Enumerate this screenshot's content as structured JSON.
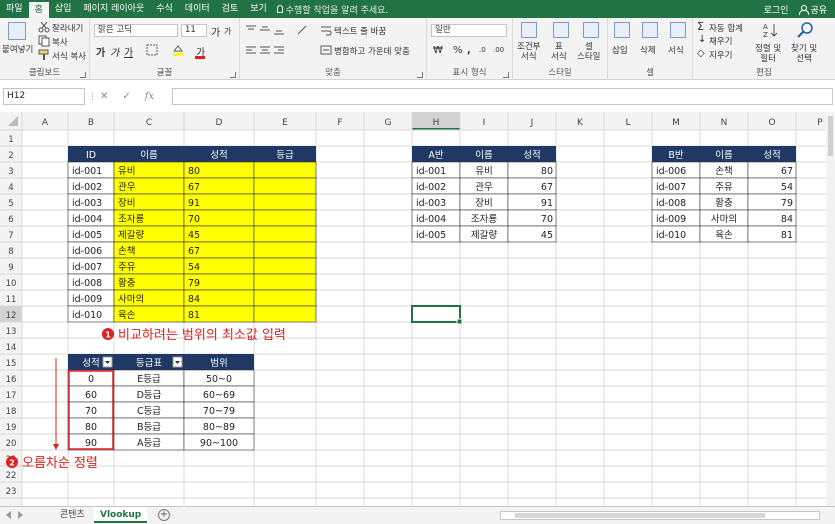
{
  "ribbon_tabs": [
    "파일",
    "홈",
    "삽입",
    "페이지 레이아웃",
    "수식",
    "데이터",
    "검토",
    "보기"
  ],
  "active_tab": "홈",
  "tell_me_placeholder": "수행할 작업을 알려 주세요.",
  "account": {
    "login": "로그인",
    "share": "공유"
  },
  "ribbon": {
    "clipboard": {
      "paste": "붙여넣기",
      "cut": "잘라내기",
      "copy": "복사 ",
      "format_painter": "서식 복사",
      "title": "클립보드"
    },
    "font": {
      "font_name": "맑은 고딕",
      "font_size": "11",
      "grow": "가",
      "shrink": "가",
      "bold": "가",
      "italic": "가",
      "underline": "가",
      "strike": "가",
      "title": "글꼴"
    },
    "alignment": {
      "wrap_text": "텍스트 줄 바꿈",
      "merge_center": "병합하고 가운데 맞춤",
      "title": "맞춤"
    },
    "number": {
      "format": "일반",
      "title": "표시 형식"
    },
    "styles": {
      "conditional": "조건부\n서식",
      "table": "표\n서식",
      "cell": "셀\n스타일",
      "conditional_1": "조건부",
      "conditional_2": "서식 ",
      "table_1": "표",
      "table_2": "서식 ",
      "cell_1": "셀",
      "cell_2": "스타일 ",
      "title": "스타일"
    },
    "cells": {
      "insert": "삽입",
      "delete": "삭제",
      "format": "서식",
      "title": "셀"
    },
    "editing": {
      "autosum": "자동 합계",
      "fill": "채우기",
      "clear": "지우기",
      "sort_filter_1": "정렬 및",
      "sort_filter_2": "필터 ",
      "find_select_1": "찾기 및",
      "find_select_2": "선택 ",
      "title": "편집"
    }
  },
  "name_box": "H12",
  "formula_value": "",
  "fx_label": "fx",
  "columns": [
    "A",
    "B",
    "C",
    "D",
    "E",
    "F",
    "G",
    "H",
    "I",
    "J",
    "K",
    "L",
    "M",
    "N",
    "O",
    "P"
  ],
  "rows": [
    "1",
    "2",
    "3",
    "4",
    "5",
    "6",
    "7",
    "8",
    "9",
    "10",
    "11",
    "12",
    "13",
    "14",
    "15",
    "16",
    "17",
    "18",
    "19",
    "20",
    "21",
    "22",
    "23"
  ],
  "main_table": {
    "headers": [
      "ID",
      "이름",
      "성적",
      "등급"
    ],
    "rows": [
      [
        "id-001",
        "유비",
        "80",
        ""
      ],
      [
        "id-002",
        "관우",
        "67",
        ""
      ],
      [
        "id-003",
        "장비",
        "91",
        ""
      ],
      [
        "id-004",
        "조자룡",
        "70",
        ""
      ],
      [
        "id-005",
        "제갈량",
        "45",
        ""
      ],
      [
        "id-006",
        "손책",
        "67",
        ""
      ],
      [
        "id-007",
        "주유",
        "54",
        ""
      ],
      [
        "id-008",
        "황충",
        "79",
        ""
      ],
      [
        "id-009",
        "사마의",
        "84",
        ""
      ],
      [
        "id-010",
        "육손",
        "81",
        ""
      ]
    ],
    "header_color": "#1f3864",
    "highlight_color": "#ffff00"
  },
  "a_table": {
    "headers": [
      "A반",
      "이름",
      "성적"
    ],
    "rows": [
      [
        "id-001",
        "유비",
        "80"
      ],
      [
        "id-002",
        "관우",
        "67"
      ],
      [
        "id-003",
        "장비",
        "91"
      ],
      [
        "id-004",
        "조자룡",
        "70"
      ],
      [
        "id-005",
        "제갈량",
        "45"
      ]
    ]
  },
  "b_table": {
    "headers": [
      "B반",
      "이름",
      "성적"
    ],
    "rows": [
      [
        "id-006",
        "손책",
        "67"
      ],
      [
        "id-007",
        "주유",
        "54"
      ],
      [
        "id-008",
        "황충",
        "79"
      ],
      [
        "id-009",
        "사마의",
        "84"
      ],
      [
        "id-010",
        "육손",
        "81"
      ]
    ]
  },
  "grade_table": {
    "headers": [
      "성적",
      "등급표",
      "범위"
    ],
    "rows": [
      [
        "0",
        "E등급",
        "50~0"
      ],
      [
        "60",
        "D등급",
        "60~69"
      ],
      [
        "70",
        "C등급",
        "70~79"
      ],
      [
        "80",
        "B등급",
        "80~89"
      ],
      [
        "90",
        "A등급",
        "90~100"
      ]
    ]
  },
  "annotations": {
    "note1_number": "1",
    "note1": "비교하려는 범위의 최소값 입력",
    "note2_number": "2",
    "note2": "오름차순 정렬",
    "color": "#e02020"
  },
  "sheet_tabs": [
    "콘텐츠",
    "Vlookup"
  ],
  "active_sheet": "Vlookup",
  "add_sheet": "+",
  "selected_cell": "H12"
}
